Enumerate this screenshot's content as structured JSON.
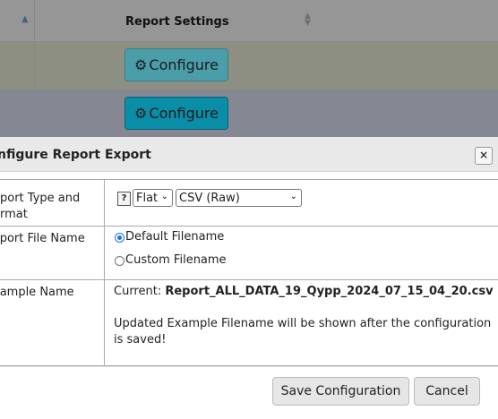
{
  "grid": {
    "column_header": "Report Settings",
    "configure_label": "Configure"
  },
  "dialog": {
    "title": "nfigure Report Export",
    "close_glyph": "×",
    "rows": {
      "type_label_line1": "eport Type and",
      "type_label_line2": "ormat",
      "help_glyph": "?",
      "format_select": "Flat",
      "output_select": "CSV (Raw)",
      "filename_label": "xport File Name",
      "default_filename": "Default Filename",
      "custom_filename": "Custom Filename",
      "example_label": "xample Name",
      "current_prefix": "Current: ",
      "current_value": "Report_ALL_DATA_19_Qypp_2024_07_15_04_20.csv",
      "updated_note_line1": "Updated Example Filename will be shown after the configuration",
      "updated_note_line2": "is saved!"
    },
    "buttons": {
      "save": "Save Configuration",
      "cancel": "Cancel"
    }
  },
  "colors": {
    "accent": "#0a8ea8",
    "radio_selected": "#1a73e8"
  }
}
